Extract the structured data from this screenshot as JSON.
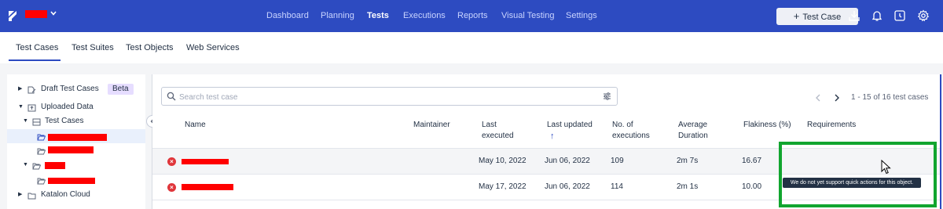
{
  "topbar": {
    "nav": [
      "Dashboard",
      "Planning",
      "Tests",
      "Executions",
      "Reports",
      "Visual Testing",
      "Settings"
    ],
    "active_nav": "Tests",
    "add_button": "Test Case",
    "icons": [
      "download-icon",
      "bell-icon",
      "history-icon",
      "gear-icon"
    ]
  },
  "subtabs": [
    "Test Cases",
    "Test Suites",
    "Test Objects",
    "Web Services"
  ],
  "active_subtab": "Test Cases",
  "tree": {
    "draft": "Draft Test Cases",
    "beta": "Beta",
    "uploaded": "Uploaded Data",
    "test_cases": "Test Cases",
    "katalon_cloud": "Katalon Cloud"
  },
  "search": {
    "placeholder": "Search test case"
  },
  "pager": {
    "text": "1 - 15 of 16 test cases"
  },
  "table": {
    "headers": {
      "name": "Name",
      "maintainer": "Maintainer",
      "last_executed_1": "Last",
      "last_executed_2": "executed",
      "last_updated": "Last updated",
      "sort_arrow": "↑",
      "executions_1": "No. of",
      "executions_2": "executions",
      "duration_1": "Average",
      "duration_2": "Duration",
      "flakiness": "Flakiness (%)",
      "requirements": "Requirements"
    },
    "rows": [
      {
        "last_executed": "May 10, 2022",
        "last_updated": "Jun 06, 2022",
        "executions": "109",
        "duration": "2m 7s",
        "flakiness": "16.67"
      },
      {
        "last_executed": "May 17, 2022",
        "last_updated": "Jun 06, 2022",
        "executions": "114",
        "duration": "2m 1s",
        "flakiness": "10.00"
      }
    ]
  },
  "tooltip": "We do not yet support quick actions for this object.",
  "colors": {
    "brand": "#2d4bc1",
    "error": "#e0363b",
    "highlight_box": "#11a52f",
    "redaction": "#ff0000"
  }
}
